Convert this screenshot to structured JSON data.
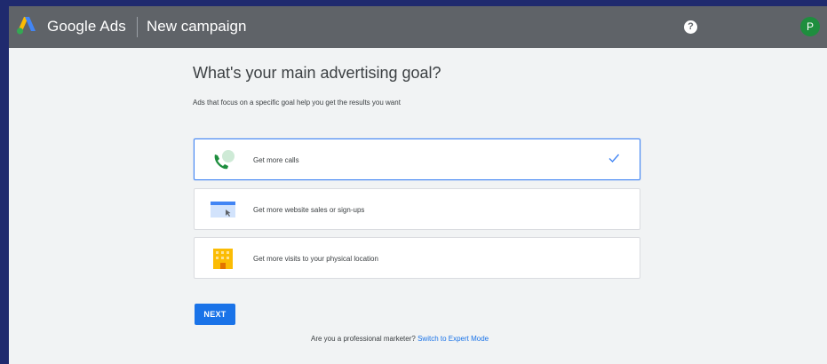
{
  "header": {
    "brand": "Google Ads",
    "page_name": "New campaign",
    "help_symbol": "?",
    "avatar_initial": "P",
    "icons": [
      "google-ads-logo-icon",
      "help-icon"
    ],
    "background_color": "#5f6368"
  },
  "main": {
    "heading": "What's your main advertising goal?",
    "subtext": "Ads that focus on a specific goal help you get the results you want",
    "goals": [
      {
        "label": "Get more calls",
        "icon": "phone-call-icon",
        "selected": true
      },
      {
        "label": "Get more website sales or sign-ups",
        "icon": "website-icon",
        "selected": false
      },
      {
        "label": "Get more visits to your physical location",
        "icon": "store-building-icon",
        "selected": false
      }
    ],
    "next_label": "NEXT",
    "footer_text": "Are you a professional marketer?",
    "footer_link": "Switch to Expert Mode"
  },
  "colors": {
    "accent": "#1a73e8",
    "selected_border": "#4285f4",
    "avatar": "#1e8e3e"
  }
}
